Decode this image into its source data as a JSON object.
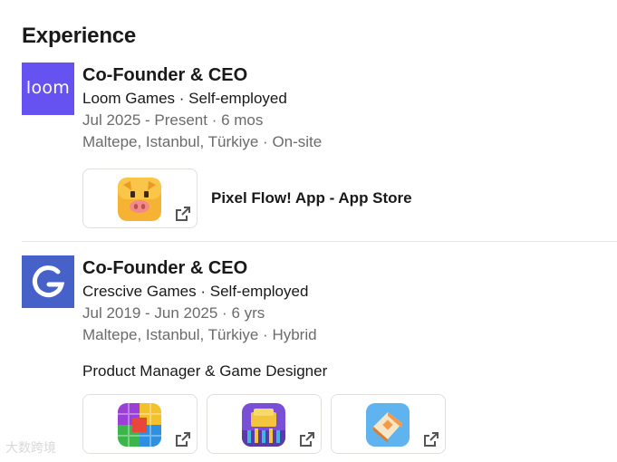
{
  "section": {
    "title": "Experience"
  },
  "experiences": [
    {
      "logo_text": "loom",
      "title": "Co-Founder & CEO",
      "company": "Loom Games · Self-employed",
      "dates": "Jul 2025 - Present · 6 mos",
      "location": "Maltepe, Istanbul, Türkiye · On-site",
      "media": [
        {
          "title": "Pixel Flow! App - App Store",
          "icon": "pig-app-icon"
        }
      ]
    },
    {
      "logo_text": "",
      "title": "Co-Founder & CEO",
      "company": "Crescive Games · Self-employed",
      "dates": "Jul 2019 - Jun 2025 · 6 yrs",
      "location": "Maltepe, Istanbul, Türkiye · Hybrid",
      "description": "Product Manager & Game Designer",
      "media": [
        {
          "icon": "colorful-blocks-app-icon"
        },
        {
          "icon": "money-stack-app-icon"
        },
        {
          "icon": "building-blocks-app-icon"
        }
      ]
    }
  ],
  "colors": {
    "loom_logo": "#6552f0",
    "crescive_logo": "#4661c8",
    "divider": "#e6e6e6",
    "meta_text": "#6b6b6b"
  },
  "watermark": "大数跨境"
}
